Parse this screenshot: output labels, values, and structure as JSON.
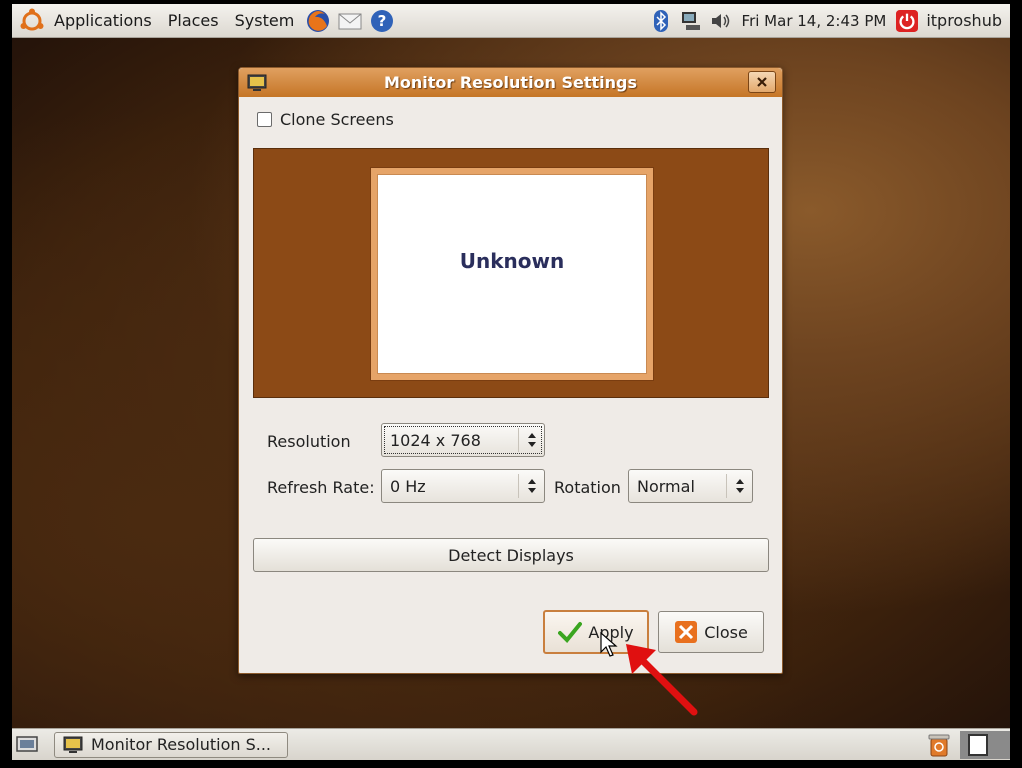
{
  "top_panel": {
    "menus": [
      "Applications",
      "Places",
      "System"
    ],
    "clock": "Fri Mar 14,  2:43 PM",
    "user": "itproshub"
  },
  "dialog": {
    "title": "Monitor Resolution Settings",
    "clone_screens_label": "Clone Screens",
    "clone_screens_checked": false,
    "monitor_name": "Unknown",
    "resolution_label": "Resolution",
    "resolution_value": "1024 x 768",
    "refresh_rate_label": "Refresh Rate:",
    "refresh_rate_value": "0 Hz",
    "rotation_label": "Rotation",
    "rotation_value": "Normal",
    "detect_button": "Detect Displays",
    "apply_button": "Apply",
    "close_button": "Close"
  },
  "bottom_panel": {
    "task_label": "Monitor Resolution S..."
  },
  "colors": {
    "titlebar": "#c57526",
    "monitor_area": "#8c4a16",
    "annotation_arrow": "#e01010"
  },
  "icons": [
    "ubuntu-logo-icon",
    "firefox-icon",
    "mail-icon",
    "help-icon",
    "bluetooth-icon",
    "network-icon",
    "volume-icon",
    "power-icon",
    "show-desktop-icon",
    "trash-icon",
    "checkmark-icon",
    "close-x-icon"
  ]
}
